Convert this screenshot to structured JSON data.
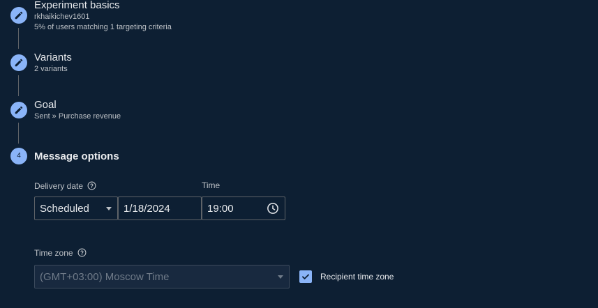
{
  "steps": [
    {
      "title": "Experiment basics",
      "subtitle1": "rkhaikichev1601",
      "subtitle2": "5% of users matching 1 targeting criteria",
      "icon": "pencil-icon"
    },
    {
      "title": "Variants",
      "subtitle1": "2 variants",
      "icon": "pencil-icon"
    },
    {
      "title": "Goal",
      "subtitle1": "Sent » Purchase revenue",
      "icon": "pencil-icon"
    },
    {
      "title": "Message options",
      "number": "4"
    }
  ],
  "delivery": {
    "date_label": "Delivery date",
    "schedule_value": "Scheduled",
    "date_value": "1/18/2024",
    "time_label": "Time",
    "time_value": "19:00"
  },
  "timezone": {
    "label": "Time zone",
    "value": "(GMT+03:00) Moscow Time",
    "recipient_label": "Recipient time zone",
    "recipient_checked": true
  },
  "colors": {
    "background": "#0d1f33",
    "accent": "#8ab4f8"
  }
}
